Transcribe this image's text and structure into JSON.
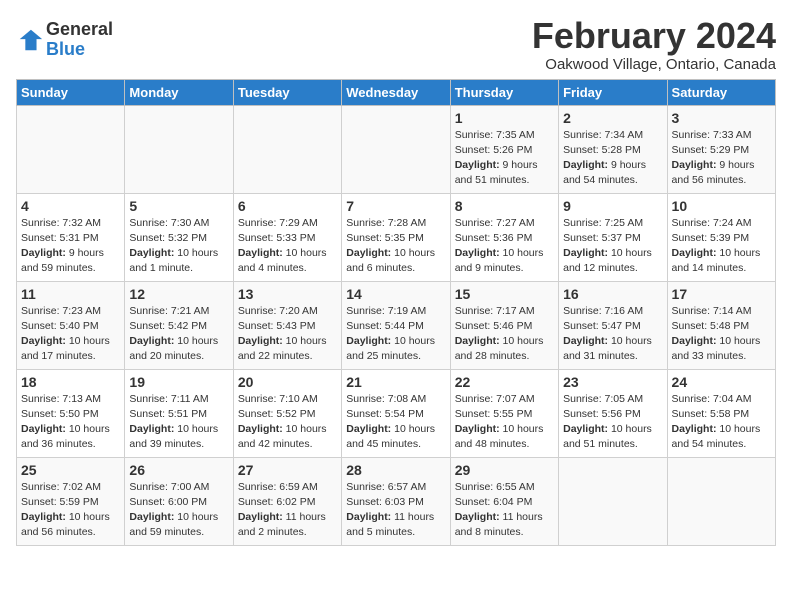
{
  "logo": {
    "line1": "General",
    "line2": "Blue"
  },
  "title": "February 2024",
  "location": "Oakwood Village, Ontario, Canada",
  "days_of_week": [
    "Sunday",
    "Monday",
    "Tuesday",
    "Wednesday",
    "Thursday",
    "Friday",
    "Saturday"
  ],
  "weeks": [
    [
      {
        "day": "",
        "sunrise": "",
        "sunset": "",
        "daylight": ""
      },
      {
        "day": "",
        "sunrise": "",
        "sunset": "",
        "daylight": ""
      },
      {
        "day": "",
        "sunrise": "",
        "sunset": "",
        "daylight": ""
      },
      {
        "day": "",
        "sunrise": "",
        "sunset": "",
        "daylight": ""
      },
      {
        "day": "1",
        "sunrise": "Sunrise: 7:35 AM",
        "sunset": "Sunset: 5:26 PM",
        "daylight": "Daylight: 9 hours and 51 minutes."
      },
      {
        "day": "2",
        "sunrise": "Sunrise: 7:34 AM",
        "sunset": "Sunset: 5:28 PM",
        "daylight": "Daylight: 9 hours and 54 minutes."
      },
      {
        "day": "3",
        "sunrise": "Sunrise: 7:33 AM",
        "sunset": "Sunset: 5:29 PM",
        "daylight": "Daylight: 9 hours and 56 minutes."
      }
    ],
    [
      {
        "day": "4",
        "sunrise": "Sunrise: 7:32 AM",
        "sunset": "Sunset: 5:31 PM",
        "daylight": "Daylight: 9 hours and 59 minutes."
      },
      {
        "day": "5",
        "sunrise": "Sunrise: 7:30 AM",
        "sunset": "Sunset: 5:32 PM",
        "daylight": "Daylight: 10 hours and 1 minute."
      },
      {
        "day": "6",
        "sunrise": "Sunrise: 7:29 AM",
        "sunset": "Sunset: 5:33 PM",
        "daylight": "Daylight: 10 hours and 4 minutes."
      },
      {
        "day": "7",
        "sunrise": "Sunrise: 7:28 AM",
        "sunset": "Sunset: 5:35 PM",
        "daylight": "Daylight: 10 hours and 6 minutes."
      },
      {
        "day": "8",
        "sunrise": "Sunrise: 7:27 AM",
        "sunset": "Sunset: 5:36 PM",
        "daylight": "Daylight: 10 hours and 9 minutes."
      },
      {
        "day": "9",
        "sunrise": "Sunrise: 7:25 AM",
        "sunset": "Sunset: 5:37 PM",
        "daylight": "Daylight: 10 hours and 12 minutes."
      },
      {
        "day": "10",
        "sunrise": "Sunrise: 7:24 AM",
        "sunset": "Sunset: 5:39 PM",
        "daylight": "Daylight: 10 hours and 14 minutes."
      }
    ],
    [
      {
        "day": "11",
        "sunrise": "Sunrise: 7:23 AM",
        "sunset": "Sunset: 5:40 PM",
        "daylight": "Daylight: 10 hours and 17 minutes."
      },
      {
        "day": "12",
        "sunrise": "Sunrise: 7:21 AM",
        "sunset": "Sunset: 5:42 PM",
        "daylight": "Daylight: 10 hours and 20 minutes."
      },
      {
        "day": "13",
        "sunrise": "Sunrise: 7:20 AM",
        "sunset": "Sunset: 5:43 PM",
        "daylight": "Daylight: 10 hours and 22 minutes."
      },
      {
        "day": "14",
        "sunrise": "Sunrise: 7:19 AM",
        "sunset": "Sunset: 5:44 PM",
        "daylight": "Daylight: 10 hours and 25 minutes."
      },
      {
        "day": "15",
        "sunrise": "Sunrise: 7:17 AM",
        "sunset": "Sunset: 5:46 PM",
        "daylight": "Daylight: 10 hours and 28 minutes."
      },
      {
        "day": "16",
        "sunrise": "Sunrise: 7:16 AM",
        "sunset": "Sunset: 5:47 PM",
        "daylight": "Daylight: 10 hours and 31 minutes."
      },
      {
        "day": "17",
        "sunrise": "Sunrise: 7:14 AM",
        "sunset": "Sunset: 5:48 PM",
        "daylight": "Daylight: 10 hours and 33 minutes."
      }
    ],
    [
      {
        "day": "18",
        "sunrise": "Sunrise: 7:13 AM",
        "sunset": "Sunset: 5:50 PM",
        "daylight": "Daylight: 10 hours and 36 minutes."
      },
      {
        "day": "19",
        "sunrise": "Sunrise: 7:11 AM",
        "sunset": "Sunset: 5:51 PM",
        "daylight": "Daylight: 10 hours and 39 minutes."
      },
      {
        "day": "20",
        "sunrise": "Sunrise: 7:10 AM",
        "sunset": "Sunset: 5:52 PM",
        "daylight": "Daylight: 10 hours and 42 minutes."
      },
      {
        "day": "21",
        "sunrise": "Sunrise: 7:08 AM",
        "sunset": "Sunset: 5:54 PM",
        "daylight": "Daylight: 10 hours and 45 minutes."
      },
      {
        "day": "22",
        "sunrise": "Sunrise: 7:07 AM",
        "sunset": "Sunset: 5:55 PM",
        "daylight": "Daylight: 10 hours and 48 minutes."
      },
      {
        "day": "23",
        "sunrise": "Sunrise: 7:05 AM",
        "sunset": "Sunset: 5:56 PM",
        "daylight": "Daylight: 10 hours and 51 minutes."
      },
      {
        "day": "24",
        "sunrise": "Sunrise: 7:04 AM",
        "sunset": "Sunset: 5:58 PM",
        "daylight": "Daylight: 10 hours and 54 minutes."
      }
    ],
    [
      {
        "day": "25",
        "sunrise": "Sunrise: 7:02 AM",
        "sunset": "Sunset: 5:59 PM",
        "daylight": "Daylight: 10 hours and 56 minutes."
      },
      {
        "day": "26",
        "sunrise": "Sunrise: 7:00 AM",
        "sunset": "Sunset: 6:00 PM",
        "daylight": "Daylight: 10 hours and 59 minutes."
      },
      {
        "day": "27",
        "sunrise": "Sunrise: 6:59 AM",
        "sunset": "Sunset: 6:02 PM",
        "daylight": "Daylight: 11 hours and 2 minutes."
      },
      {
        "day": "28",
        "sunrise": "Sunrise: 6:57 AM",
        "sunset": "Sunset: 6:03 PM",
        "daylight": "Daylight: 11 hours and 5 minutes."
      },
      {
        "day": "29",
        "sunrise": "Sunrise: 6:55 AM",
        "sunset": "Sunset: 6:04 PM",
        "daylight": "Daylight: 11 hours and 8 minutes."
      },
      {
        "day": "",
        "sunrise": "",
        "sunset": "",
        "daylight": ""
      },
      {
        "day": "",
        "sunrise": "",
        "sunset": "",
        "daylight": ""
      }
    ]
  ]
}
